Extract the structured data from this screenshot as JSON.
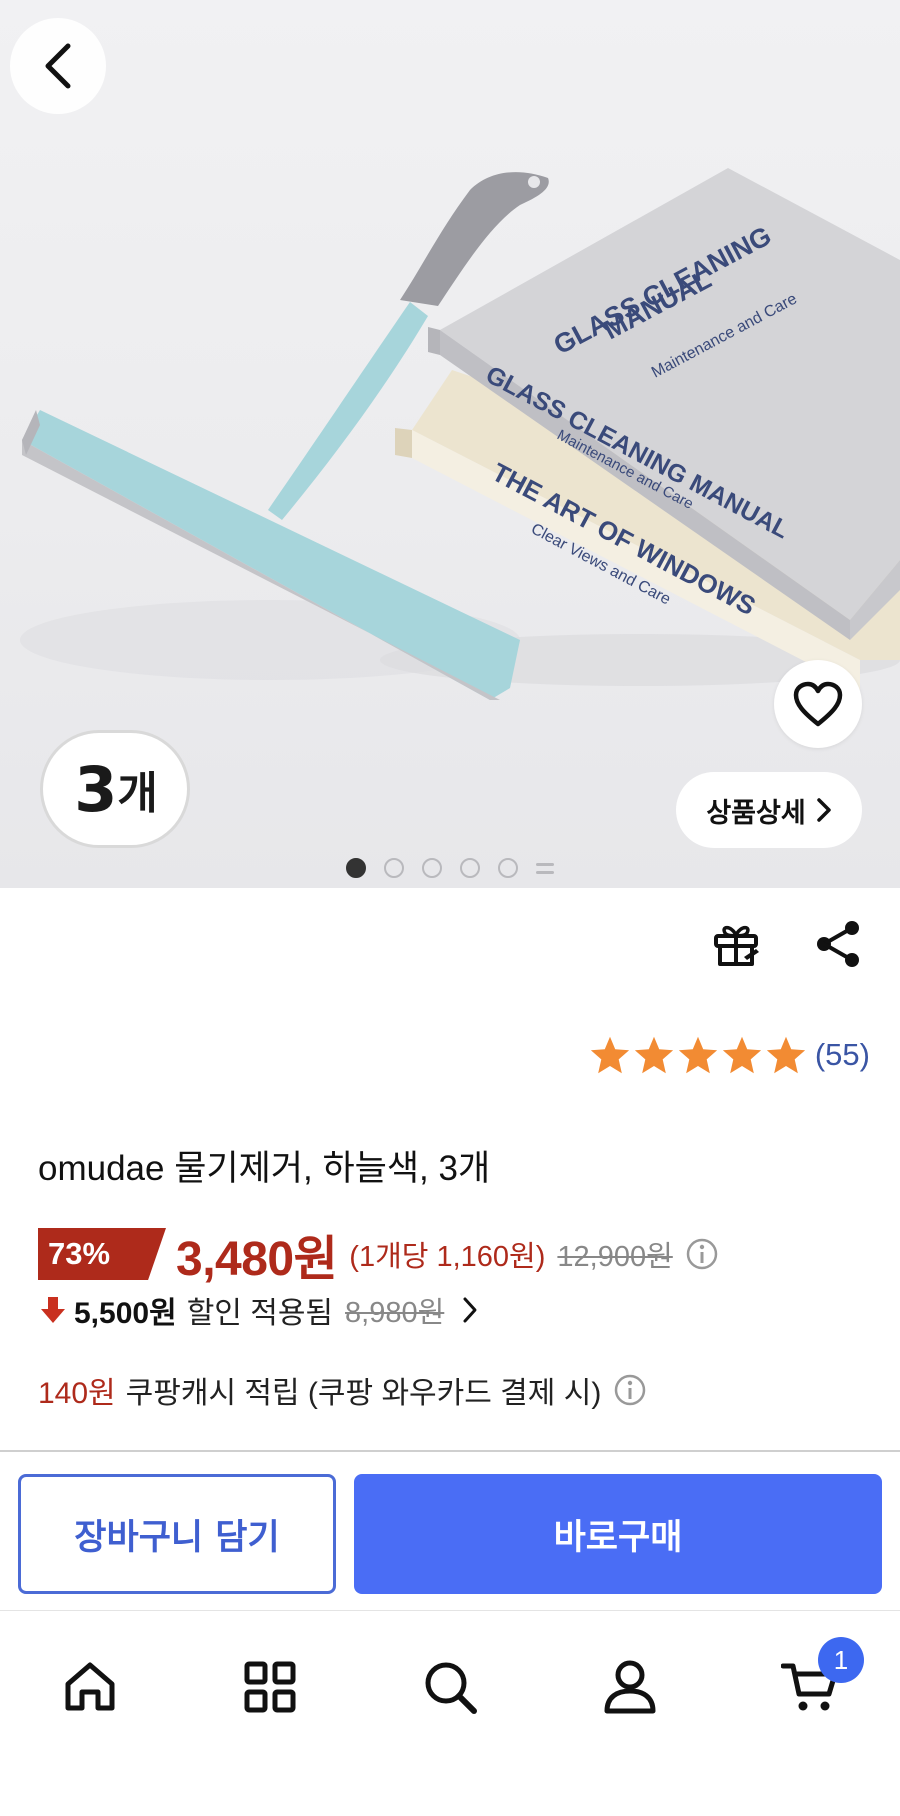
{
  "hero": {
    "count_badge_number": "3",
    "count_badge_unit": "개",
    "detail_button_label": "상품상세",
    "image_count": 6,
    "active_image_index": 0,
    "book_top_title_line1": "GLASS CLEANING",
    "book_top_title_line2": "MANUAL",
    "book_top_subtitle": "Maintenance and Care",
    "book_spine1_title": "GLASS CLEANING MANUAL",
    "book_spine1_subtitle": "Maintenance and Care",
    "book_spine2_title": "THE ART OF WINDOWS",
    "book_spine2_subtitle": "Clear Views and Care"
  },
  "actions": {
    "gift_icon": "gift-icon",
    "share_icon": "share-icon"
  },
  "rating": {
    "stars": 5,
    "review_count": "(55)",
    "star_color": "#f28b33"
  },
  "product": {
    "title": "omudae 물기제거, 하늘색, 3개",
    "discount_rate": "73%",
    "sale_price": "3,480원",
    "unit_price": "(1개당 1,160원)",
    "original_price": "12,900원",
    "coupon_amount": "5,500원",
    "coupon_text": "할인 적용됨",
    "coupon_original": "8,980원",
    "cash_amount": "140원",
    "cash_text": "쿠팡캐시 적립 (쿠팡 와우카드 결제 시)"
  },
  "cta": {
    "cart_label": "장바구니 담기",
    "buy_label": "바로구매"
  },
  "tab_bar": {
    "items": [
      "home-icon",
      "category-icon",
      "search-icon",
      "profile-icon",
      "cart-icon"
    ],
    "cart_badge": "1"
  },
  "colors": {
    "accent_red": "#ae2a1b",
    "accent_blue": "#4a6df5",
    "rating_blue": "#3a55a4"
  }
}
